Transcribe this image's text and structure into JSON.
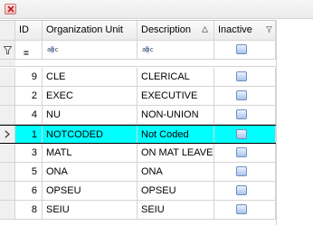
{
  "columns": {
    "id": "ID",
    "org_unit": "Organization Unit",
    "description": "Description",
    "inactive": "Inactive"
  },
  "filter": {
    "id_operator": "=",
    "text_icon_left": "a",
    "text_icon_mid": "b",
    "text_icon_right": "c"
  },
  "rows": [
    {
      "id": "9",
      "org_unit": "CLE",
      "description": "CLERICAL",
      "inactive": false
    },
    {
      "id": "2",
      "org_unit": "EXEC",
      "description": "EXECUTIVE",
      "inactive": false
    },
    {
      "id": "4",
      "org_unit": "NU",
      "description": "NON-UNION",
      "inactive": false
    },
    {
      "id": "1",
      "org_unit": "NOTCODED",
      "description": "Not Coded",
      "inactive": false,
      "selected": true
    },
    {
      "id": "3",
      "org_unit": "MATL",
      "description": "ON MAT LEAVE",
      "inactive": false
    },
    {
      "id": "5",
      "org_unit": "ONA",
      "description": "ONA",
      "inactive": false
    },
    {
      "id": "6",
      "org_unit": "OPSEU",
      "description": "OPSEU",
      "inactive": false
    },
    {
      "id": "8",
      "org_unit": "SEIU",
      "description": "SEIU",
      "inactive": false
    }
  ],
  "colors": {
    "selected_row": "#00ffff",
    "grid_line": "#d4d4d4",
    "close_button": "#d07070"
  }
}
